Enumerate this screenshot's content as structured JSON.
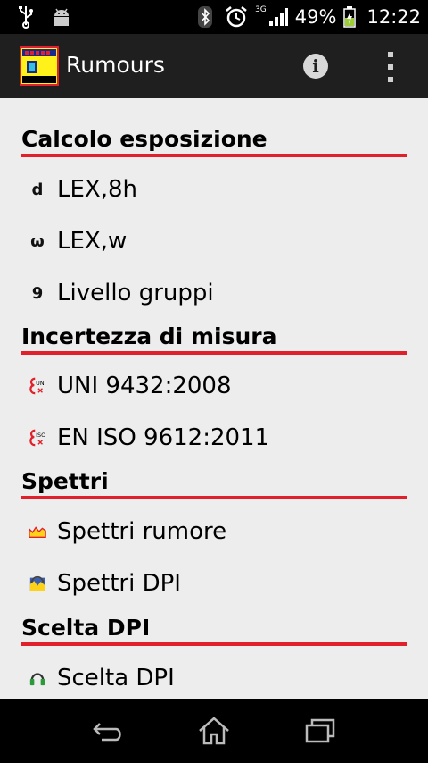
{
  "status_bar": {
    "network": "3G",
    "battery": "49%",
    "time": "12:22",
    "icons": [
      "usb-icon",
      "android-icon",
      "bluetooth-icon",
      "alarm-icon",
      "signal-icon",
      "battery-icon"
    ]
  },
  "action_bar": {
    "title": "Rumours",
    "icons": [
      "app-logo-icon",
      "info-icon",
      "overflow-menu-icon"
    ]
  },
  "sections": [
    {
      "header": "Calcolo esposizione",
      "items": [
        {
          "label": "LEX,8h",
          "glyph": "d"
        },
        {
          "label": "LEX,w",
          "glyph": "ω"
        },
        {
          "label": "Livello gruppi",
          "glyph": "9"
        }
      ]
    },
    {
      "header": "Incertezza di misura",
      "items": [
        {
          "label": "UNI 9432:2008",
          "glyph": "UNI"
        },
        {
          "label": "EN ISO 9612:2011",
          "glyph": "ISO"
        }
      ]
    },
    {
      "header": "Spettri",
      "items": [
        {
          "label": "Spettri rumore"
        },
        {
          "label": "Spettri DPI"
        }
      ]
    },
    {
      "header": "Scelta DPI",
      "items": [
        {
          "label": "Scelta DPI"
        }
      ]
    }
  ],
  "colors": {
    "accent": "#e0202a",
    "action_bar": "#1f1f1f",
    "background": "#ededed"
  },
  "nav_bar": {
    "icons": [
      "back-icon",
      "home-icon",
      "recent-apps-icon"
    ]
  }
}
